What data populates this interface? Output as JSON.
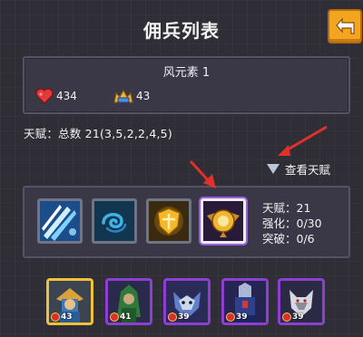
{
  "header": {
    "title": "佣兵列表",
    "back_icon": "back-arrow-icon"
  },
  "element_panel": {
    "label": "风元素  1",
    "hp": "434",
    "attack": "43"
  },
  "talent_summary": "天赋：总数 21(3,5,2,2,4,5)",
  "view_talent_label": "查看天赋",
  "skills": [
    {
      "icon": "ice-slash-icon"
    },
    {
      "icon": "wind-swirl-icon"
    },
    {
      "icon": "golden-shield-icon"
    },
    {
      "icon": "winged-emblem-icon",
      "selected": true
    }
  ],
  "skill_info": {
    "talent": "天赋：21",
    "enhance": "强化：0/30",
    "breakthrough": "突破：0/6"
  },
  "heroes": [
    {
      "level": "43",
      "frame": "gold"
    },
    {
      "level": "41",
      "frame": "purple"
    },
    {
      "level": "39",
      "frame": "purple"
    },
    {
      "level": "39",
      "frame": "purple"
    },
    {
      "level": "39",
      "frame": "purple"
    }
  ],
  "colors": {
    "accent": "#f2a51f",
    "rare_frame": "#8d3fd1",
    "legend_frame": "#f0c23a",
    "annotation": "#e0312b"
  }
}
